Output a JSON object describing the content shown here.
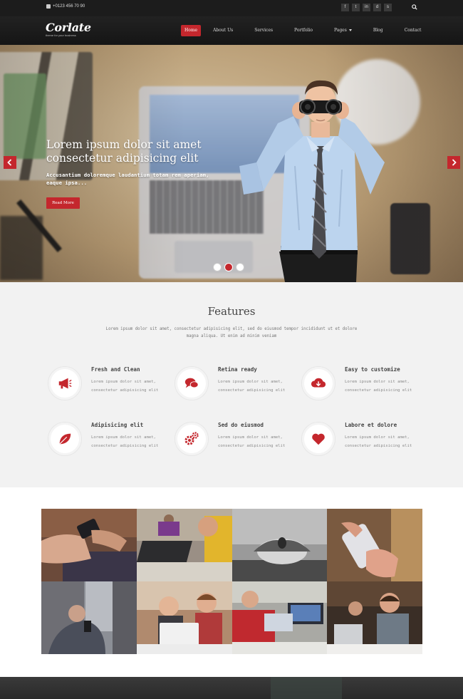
{
  "topbar": {
    "phone": "+0123 456 70 90",
    "socials": [
      "f",
      "t",
      "in",
      "d",
      "s"
    ]
  },
  "brand": {
    "name": "Corlate",
    "tagline": "theme for your business"
  },
  "nav": {
    "items": [
      {
        "label": "Home",
        "active": true
      },
      {
        "label": "About Us",
        "active": false
      },
      {
        "label": "Services",
        "active": false
      },
      {
        "label": "Portfolio",
        "active": false
      },
      {
        "label": "Pages",
        "active": false,
        "dropdown": true
      },
      {
        "label": "Blog",
        "active": false
      },
      {
        "label": "Contact",
        "active": false
      }
    ]
  },
  "hero": {
    "title": "Lorem ipsum dolor sit amet consectetur adipisicing elit",
    "subtitle": "Accusantium doloremque laudantium totam rem aperiam, eaque ipsa...",
    "button": "Read More",
    "slides": 3,
    "active_slide": 2
  },
  "features": {
    "title": "Features",
    "intro": "Lorem ipsum dolor sit amet, consectetur adipisicing elit, sed do eiusmod tempor incididunt ut et dolore magna aliqua. Ut enim ad minim veniam",
    "items": [
      {
        "title": "Fresh and Clean",
        "text": "Lorem ipsum dolor sit amet, consectetur adipisicing elit",
        "icon": "megaphone-icon"
      },
      {
        "title": "Retina ready",
        "text": "Lorem ipsum dolor sit amet, consectetur adipisicing elit",
        "icon": "chat-bubbles-icon"
      },
      {
        "title": "Easy to customize",
        "text": "Lorem ipsum dolor sit amet, consectetur adipisicing elit",
        "icon": "cloud-download-icon"
      },
      {
        "title": "Adipisicing elit",
        "text": "Lorem ipsum dolor sit amet, consectetur adipisicing elit",
        "icon": "leaf-icon"
      },
      {
        "title": "Sed do eiusmod",
        "text": "Lorem ipsum dolor sit amet, consectetur adipisicing elit",
        "icon": "gears-icon"
      },
      {
        "title": "Labore et dolore",
        "text": "Lorem ipsum dolor sit amet, consectetur adipisicing elit",
        "icon": "heart-icon"
      }
    ]
  },
  "colors": {
    "accent": "#c4272d",
    "topbar": "#1c1c1c",
    "features_bg": "#f2f2f2"
  }
}
